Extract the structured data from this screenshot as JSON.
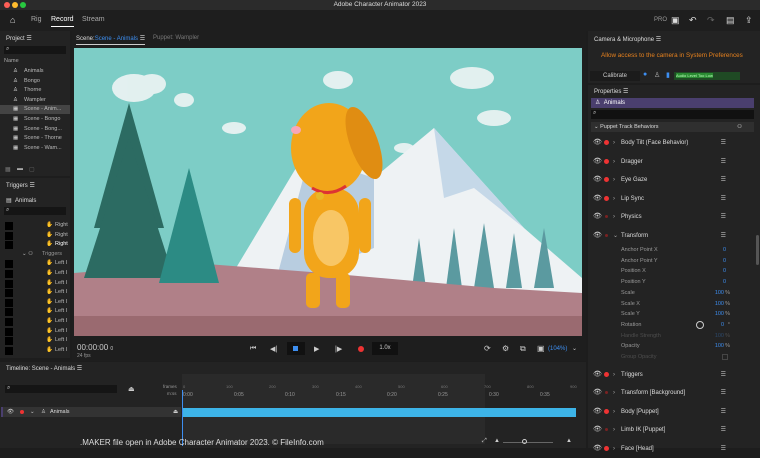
{
  "window": {
    "title": "Adobe Character Animator 2023"
  },
  "nav": {
    "tabs": [
      {
        "label": "Rig"
      },
      {
        "label": "Record"
      },
      {
        "label": "Stream"
      }
    ],
    "active": "Record",
    "pro_label": "PRO"
  },
  "project": {
    "title": "Project",
    "column": "Name",
    "items": [
      {
        "label": "Animals",
        "type": "puppet"
      },
      {
        "label": "Bongo",
        "type": "puppet"
      },
      {
        "label": "Thorne",
        "type": "puppet"
      },
      {
        "label": "Wampler",
        "type": "puppet"
      },
      {
        "label": "Scene - Anim...",
        "type": "scene",
        "selected": true
      },
      {
        "label": "Scene - Bongo",
        "type": "scene"
      },
      {
        "label": "Scene - Bong...",
        "type": "scene"
      },
      {
        "label": "Scene - Thorne",
        "type": "scene"
      },
      {
        "label": "Scene - Wam...",
        "type": "scene"
      }
    ]
  },
  "triggers": {
    "title": "Triggers",
    "puppet": "Animals",
    "items": [
      "Right",
      "Right",
      "Right",
      "Triggers",
      "Left I",
      "Left I",
      "Left I",
      "Left I",
      "Left I",
      "Left I",
      "Left I",
      "Left I",
      "Left I",
      "Left I"
    ]
  },
  "scene": {
    "tab_prefix": "Scene:",
    "tab_name": "Scene - Animals",
    "puppet_tab": "Puppet: Wampler",
    "timecode": "00:00:00",
    "timecode_suffix": "0",
    "fps": "24 fps",
    "speed": "1.0x",
    "zoom": "(104%)"
  },
  "camera": {
    "title": "Camera & Microphone",
    "warning": "Allow access to the camera in System Preferences",
    "calibrate": "Calibrate",
    "audio_level": "Audio Level Too Low"
  },
  "properties": {
    "title": "Properties",
    "puppet": "Animals",
    "section": "Puppet Track Behaviors",
    "behaviors_top": [
      {
        "label": "Body Tilt (Face Behavior)",
        "armed": true
      },
      {
        "label": "Dragger",
        "armed": true
      },
      {
        "label": "Eye Gaze",
        "armed": true
      },
      {
        "label": "Lip Sync",
        "armed": true
      },
      {
        "label": "Physics",
        "armed": false
      },
      {
        "label": "Transform",
        "armed": false,
        "expanded": true
      }
    ],
    "transform_params": [
      {
        "name": "Anchor Point X",
        "value": "0",
        "unit": ""
      },
      {
        "name": "Anchor Point Y",
        "value": "0",
        "unit": ""
      },
      {
        "name": "Position X",
        "value": "0",
        "unit": ""
      },
      {
        "name": "Position Y",
        "value": "0",
        "unit": ""
      },
      {
        "name": "Scale",
        "value": "100",
        "unit": "%"
      },
      {
        "name": "Scale X",
        "value": "100",
        "unit": "%"
      },
      {
        "name": "Scale Y",
        "value": "100",
        "unit": "%"
      },
      {
        "name": "Rotation",
        "value": "0",
        "unit": "°"
      },
      {
        "name": "Handle Strength",
        "value": "100",
        "unit": "%",
        "disabled": true
      },
      {
        "name": "Opacity",
        "value": "100",
        "unit": "%"
      },
      {
        "name": "Group Opacity",
        "value": "",
        "unit": "",
        "disabled": true
      }
    ],
    "behaviors_bottom": [
      {
        "label": "Triggers",
        "armed": true
      },
      {
        "label": "Transform [Background]",
        "armed": false
      },
      {
        "label": "Body [Puppet]",
        "armed": true
      },
      {
        "label": "Limb IK [Puppet]",
        "armed": false
      },
      {
        "label": "Face [Head]",
        "armed": true
      }
    ]
  },
  "timeline": {
    "title": "Timeline: Scene - Animals",
    "frames_label": "frames",
    "mss_label": "m:ss",
    "track": "Animals",
    "time_ticks": [
      "0:00",
      "0:05",
      "0:10",
      "0:15",
      "0:20",
      "0:25",
      "0:30",
      "0:35"
    ],
    "frame_ticks": [
      "0",
      "100",
      "200",
      "300",
      "400",
      "500",
      "600",
      "700",
      "800",
      "900"
    ]
  },
  "footer": {
    "watermark": ".MAKER file open in Adobe Character Animator 2023. © FileInfo.com"
  },
  "colors": {
    "accent": "#3d8ef0",
    "record": "#e33333",
    "warning": "#e8821e",
    "track": "#3db4e8",
    "selection": "#4a3f6e"
  }
}
